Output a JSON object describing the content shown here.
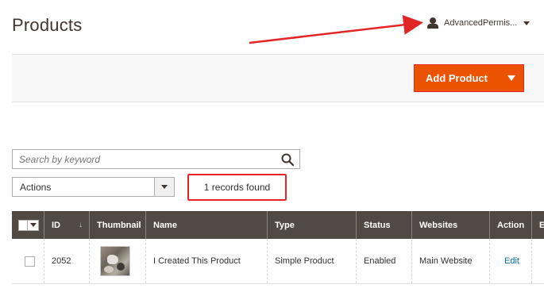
{
  "page": {
    "title": "Products"
  },
  "user_menu": {
    "name": "AdvancedPermis..."
  },
  "toolbar": {
    "add_product_label": "Add Product"
  },
  "search": {
    "placeholder": "Search by keyword",
    "value": ""
  },
  "mass_actions": {
    "selected": "Actions"
  },
  "records_found": "1 records found",
  "grid": {
    "columns": {
      "id": "ID",
      "thumbnail": "Thumbnail",
      "name": "Name",
      "type": "Type",
      "status": "Status",
      "websites": "Websites",
      "action": "Action",
      "edit": "Ed"
    },
    "rows": [
      {
        "id": "2052",
        "name": "I Created This Product",
        "type": "Simple Product",
        "status": "Enabled",
        "websites": "Main Website",
        "action": "Edit"
      }
    ]
  },
  "colors": {
    "accent": "#eb5202",
    "annotation_red": "#e22626",
    "grid_header": "#514943",
    "link": "#006bb4"
  },
  "icons": {
    "user": "user-icon",
    "search": "search-icon",
    "dropdown": "chevron-down-icon"
  }
}
